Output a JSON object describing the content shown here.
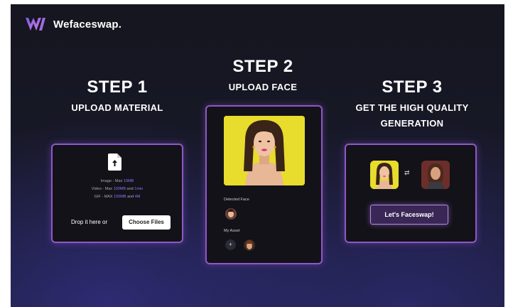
{
  "brand": {
    "name": "Wefaceswap."
  },
  "steps": [
    {
      "number": "STEP 1",
      "title_lines": [
        "UPLOAD MATERIAL"
      ]
    },
    {
      "number": "STEP 2",
      "title_lines": [
        "UPLOAD FACE"
      ]
    },
    {
      "number": "STEP 3",
      "title_lines": [
        "GET THE HIGH QUALITY",
        "GENERATION"
      ]
    }
  ],
  "upload_card": {
    "icon": "file-upload-icon",
    "limits": [
      {
        "label": "Image - Max",
        "values": [
          "10MB"
        ],
        "joiner": ""
      },
      {
        "label": "Video - Max",
        "values": [
          "100MB",
          "1min"
        ],
        "joiner": "and"
      },
      {
        "label": "GIF - MAX",
        "values": [
          "100MB",
          "4M"
        ],
        "joiner": "and"
      }
    ],
    "drop_text": "Drop it here or",
    "choose_button": "Choose Files"
  },
  "face_card": {
    "detected_label": "Detected Face",
    "asset_label": "My Asset",
    "add_icon": "+"
  },
  "result_card": {
    "swap_icon": "⇄",
    "button": "Let's Faceswap!"
  },
  "colors": {
    "accent": "#8f57c9",
    "highlight": "#8d79ff",
    "photo_bg": "#e8dc2c"
  }
}
